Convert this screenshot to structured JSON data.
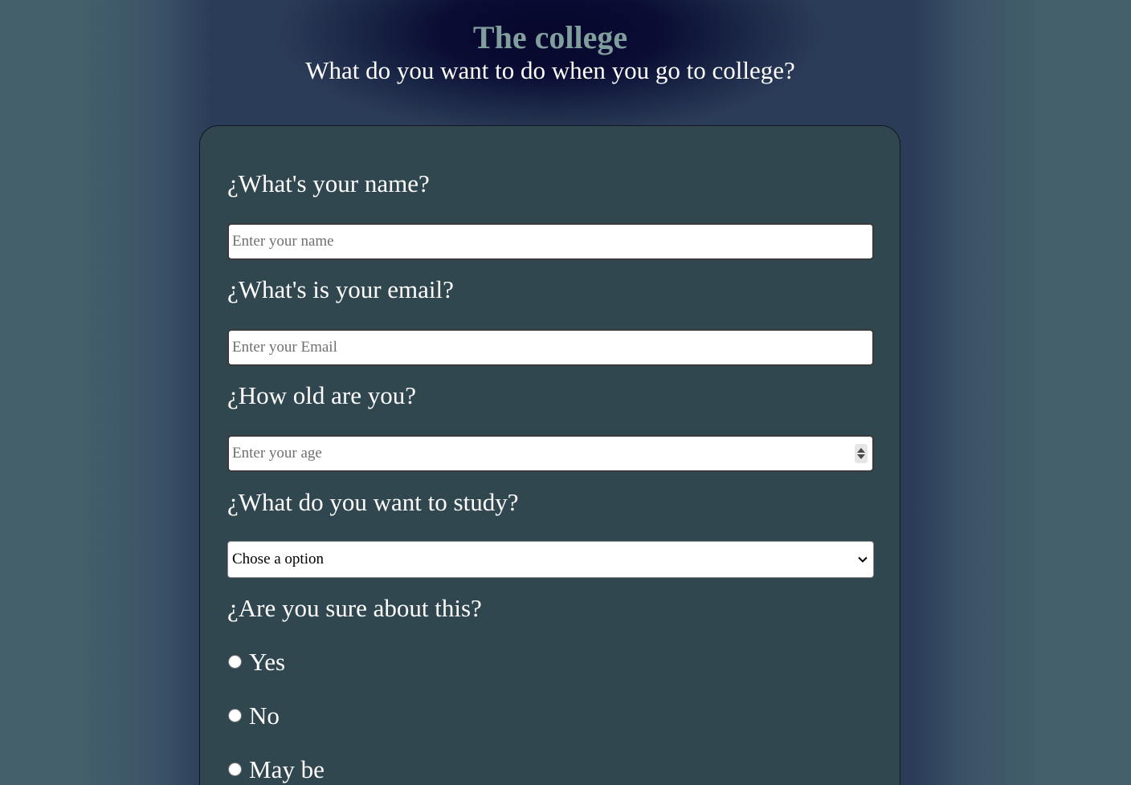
{
  "header": {
    "title": "The college",
    "subtitle": "What do you want to do when you go to college?"
  },
  "form": {
    "name": {
      "question": "¿What's your name?",
      "placeholder": "Enter your name",
      "value": ""
    },
    "email": {
      "question": "¿What's is your email?",
      "placeholder": "Enter your Email",
      "value": ""
    },
    "age": {
      "question": "¿How old are you?",
      "placeholder": "Enter your age",
      "value": ""
    },
    "study": {
      "question": "¿What do you want to study?",
      "selected": "Chose a option"
    },
    "sure": {
      "question": "¿Are you sure about this?",
      "options": [
        {
          "label": "Yes",
          "checked": false
        },
        {
          "label": "No",
          "checked": false
        },
        {
          "label": "May be",
          "checked": false
        }
      ]
    }
  },
  "colors": {
    "background": "#43606b",
    "card": "#31474f",
    "title": "#7f9e9c",
    "text": "#ffffff",
    "header_glow": "#07072d"
  },
  "icons": {
    "select": "chevron-down-icon",
    "age_stepper": "spinner-arrows-icon"
  }
}
